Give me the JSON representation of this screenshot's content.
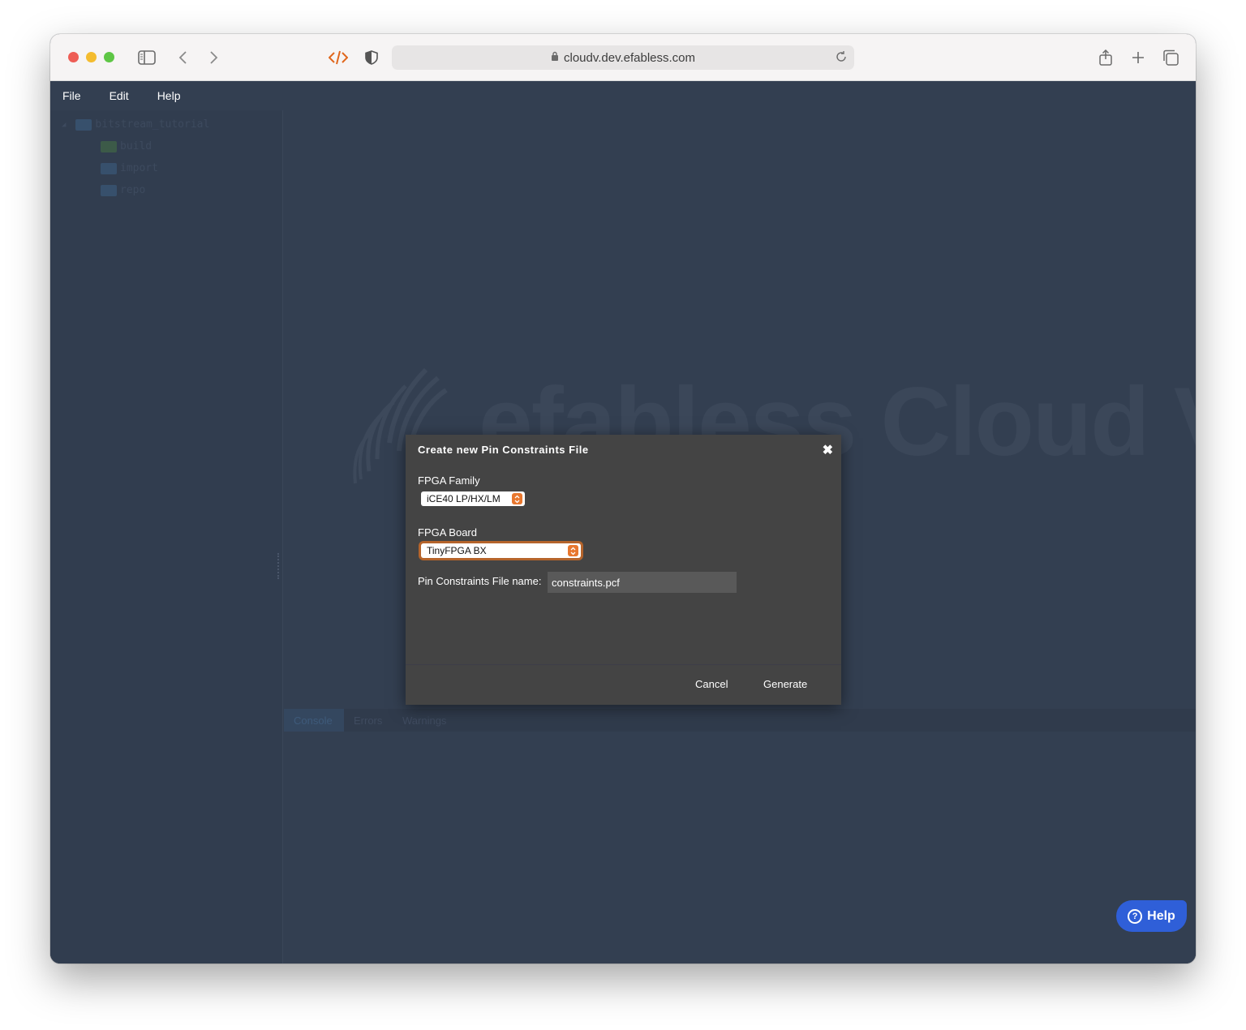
{
  "browser": {
    "url": "cloudv.dev.efabless.com",
    "icons": [
      "sidebar-icon",
      "back-icon",
      "forward-icon",
      "dev-tools-icon",
      "privacy-shield-icon",
      "lock-icon",
      "reload-icon",
      "share-icon",
      "new-tab-icon",
      "tabs-overview-icon"
    ]
  },
  "menubar": {
    "items": [
      "File",
      "Edit",
      "Help"
    ]
  },
  "file_tree": {
    "root": "bitstream_tutorial",
    "children": [
      "build",
      "import",
      "repo"
    ]
  },
  "watermark": {
    "text": "efabless Cloud V"
  },
  "bottom_panel": {
    "tabs": [
      "Console",
      "Errors",
      "Warnings"
    ]
  },
  "dialog": {
    "title": "Create new Pin Constraints File",
    "close_symbol": "✖",
    "family_label": "FPGA Family",
    "family_value": "iCE40 LP/HX/LM",
    "board_label": "FPGA Board",
    "board_value": "TinyFPGA BX",
    "filename_label": "Pin Constraints File name:",
    "filename_value": "constraints.pcf",
    "cancel_label": "Cancel",
    "generate_label": "Generate"
  },
  "help_button": {
    "label": "Help"
  },
  "colors": {
    "accent_orange": "#e8772e",
    "help_blue": "#2f5fd8",
    "app_bg": "#333f51",
    "dialog_bg": "#444444"
  }
}
